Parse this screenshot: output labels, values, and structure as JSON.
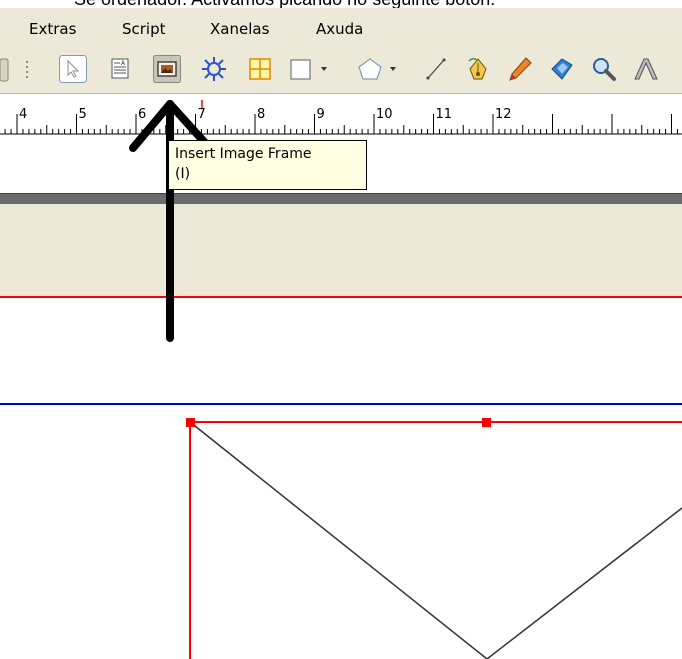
{
  "caption": "Se ordenador. Activamos picando no seguinte botón:",
  "menubar": {
    "items": [
      {
        "label": "Extras"
      },
      {
        "label": "Script"
      },
      {
        "label": "Xanelas"
      },
      {
        "label": "Axuda"
      }
    ]
  },
  "ruler": {
    "labels": [
      "4",
      "5",
      "6",
      "7",
      "8",
      "9",
      "10",
      "11",
      "12"
    ]
  },
  "tooltip": {
    "line1": "Insert Image Frame",
    "line2": "(I)"
  },
  "colors": {
    "chrome": "#ece9d8",
    "margin_red": "#ff0000",
    "guide_blue": "#0000cc",
    "tooltip_bg": "#ffffe1",
    "selected_button_bg": "#c9c6b8"
  },
  "icons": [
    "select-arrow-icon",
    "text-frame-icon",
    "image-frame-icon",
    "render-frame-icon",
    "table-icon",
    "shape-icon",
    "polygon-icon",
    "line-icon",
    "bezier-icon",
    "freehand-icon",
    "rotate-icon",
    "zoom-icon",
    "edit-text-icon"
  ]
}
